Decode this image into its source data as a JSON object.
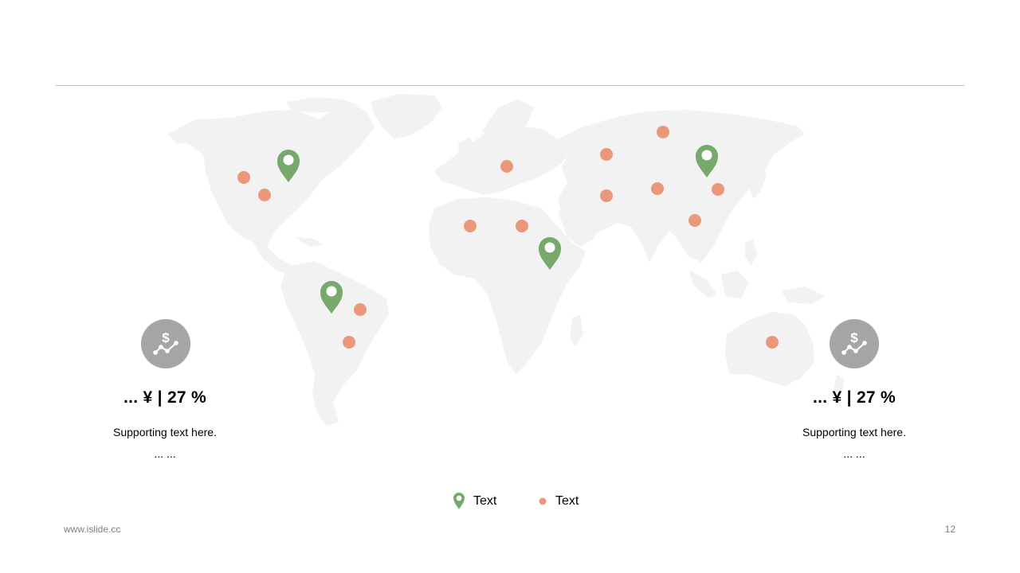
{
  "colors": {
    "land": "#f2f2f2",
    "pin": "#76a96b",
    "dot": "#ea9879",
    "stat_circle": "#a6a6a6"
  },
  "icons": {
    "pin": "map-pin-icon",
    "dot": "dot-marker-icon",
    "stat": "dollar-trend-icon"
  },
  "stats": [
    {
      "value": "...  ¥  | 27 %",
      "text_line1": "Supporting  text here.",
      "text_line2": "... ..."
    },
    {
      "value": "...  ¥  | 27 %",
      "text_line1": "Supporting  text here.",
      "text_line2": "... ..."
    }
  ],
  "legend": {
    "pin_label": "Text",
    "dot_label": "Text"
  },
  "footer": {
    "url": "www.islide.cc",
    "page_number": "12"
  }
}
